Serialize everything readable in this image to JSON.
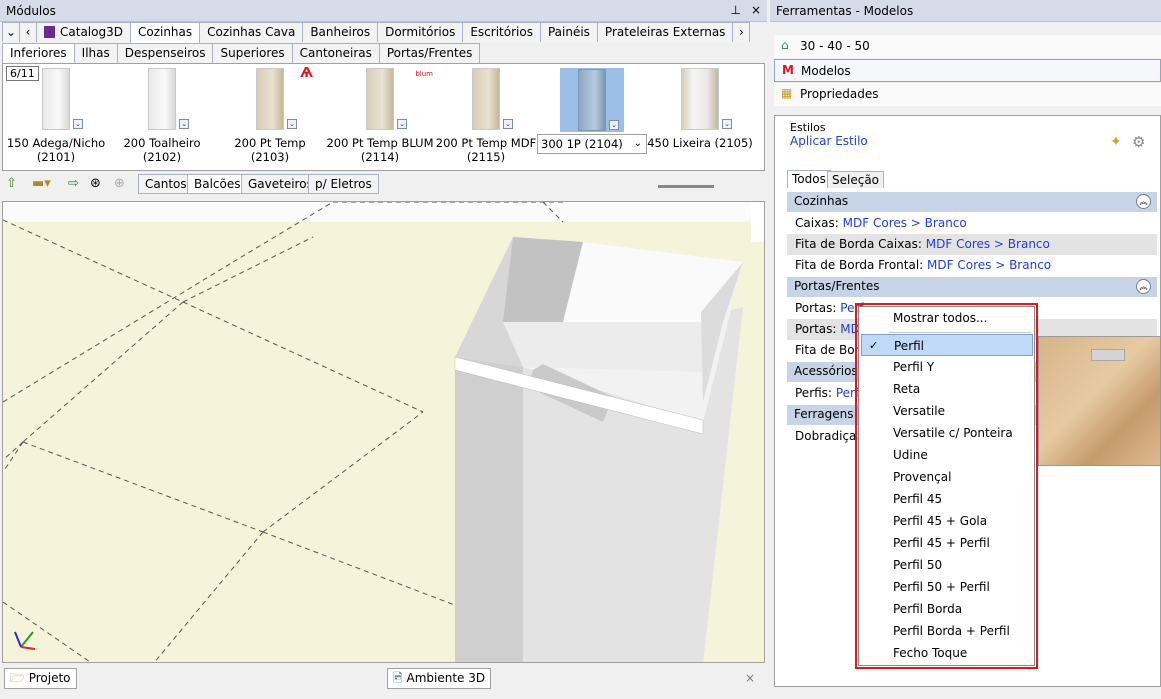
{
  "left_panel": {
    "title": "Módulos",
    "pin": "ᵖ",
    "close": "×",
    "top_tabs": [
      "Catalog3D",
      "Cozinhas",
      "Cozinhas Cava",
      "Banheiros",
      "Dormitórios",
      "Escritórios",
      "Painéis",
      "Prateleiras Externas"
    ],
    "active_top_tab": "Cozinhas",
    "sub_tabs": [
      "Inferiores",
      "Ilhas",
      "Despenseiros",
      "Superiores",
      "Cantoneiras",
      "Portas/Frentes"
    ],
    "active_sub_tab": "Inferiores",
    "page_counter": "6/11",
    "items": [
      {
        "label": "150 Adega/Nicho (2101)"
      },
      {
        "label": "200 Toalheiro (2102)"
      },
      {
        "label": "200 Pt Temp (2103)"
      },
      {
        "label": "200 Pt Temp BLUM (2114)"
      },
      {
        "label": "200 Pt Temp MDF (2115)"
      },
      {
        "label": "300 1P (2104)"
      },
      {
        "label": "450 Lixeira (2105)"
      }
    ],
    "blum_badge": "blum",
    "view_tabs": [
      "Cantos",
      "Balcões",
      "Gaveteiros",
      "p/ Eletros"
    ],
    "active_view_tab": "Balcões",
    "bottom_tabs": [
      "Projeto",
      "Ambiente 3D"
    ],
    "bottom_close": "×"
  },
  "right_panel": {
    "title": "Ferramentas - Modelos",
    "nav": [
      "30 - 40 - 50",
      "Modelos",
      "Propriedades"
    ],
    "active_nav": "Modelos",
    "estilos_label": "Estilos",
    "apply_style": "Aplicar Estilo",
    "filter_tabs": [
      "Todos",
      "Seleção"
    ],
    "sections": {
      "cozinhas": {
        "title": "Cozinhas",
        "rows": [
          {
            "label": "Caixas:",
            "value": "MDF Cores > Branco"
          },
          {
            "label": "Fita de Borda Caixas:",
            "value": "MDF Cores > Branco"
          },
          {
            "label": "Fita de Borda Frontal:",
            "value": "MDF Cores > Branco"
          }
        ]
      },
      "portas": {
        "title": "Portas/Frentes",
        "rows": [
          {
            "label": "Portas:",
            "value": "Perf"
          },
          {
            "label": "Portas:",
            "value": "MD"
          },
          {
            "label": "Fita de Borda",
            "value": ""
          }
        ]
      },
      "acessorios": {
        "title": "Acessórios",
        "rows": [
          {
            "label": "Perfis:",
            "value": "Perf"
          }
        ]
      },
      "ferragens": {
        "title": "Ferragens",
        "rows": [
          {
            "label": "Dobradiça:",
            "value": ""
          }
        ]
      }
    }
  },
  "menu": {
    "items": [
      "Mostrar todos...",
      "Perfil",
      "Perfil Y",
      "Reta",
      "Versatile",
      "Versatile c/ Ponteira",
      "Udine",
      "Provençal",
      "Perfil 45",
      "Perfil 45 + Gola",
      "Perfil 45 + Perfil",
      "Perfil 50",
      "Perfil 50 + Perfil",
      "Perfil Borda",
      "Perfil Borda + Perfil",
      "Fecho Toque"
    ],
    "selected": "Perfil",
    "check": "✓"
  },
  "colors": {
    "accent": "#2340d4",
    "highlight_frame": "#e0161e",
    "header": "#d6dbe9",
    "section": "#c7d3e7"
  }
}
